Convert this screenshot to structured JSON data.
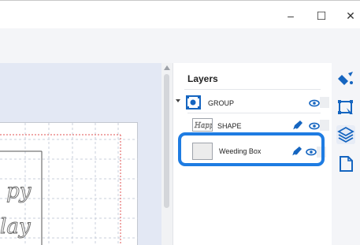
{
  "window": {
    "minimize_glyph": "–",
    "maximize_glyph": "☐",
    "close_glyph": "✕"
  },
  "layers_panel": {
    "title": "Layers",
    "layers": [
      {
        "label": "GROUP",
        "icon": "group-icon",
        "expanded": true,
        "visible": true
      },
      {
        "label": "SHAPE",
        "icon": "shape-thumbnail",
        "visible": true,
        "has_edit_pen": true
      },
      {
        "label": "Weeding Box",
        "icon": "weeding-box-thumbnail",
        "visible": true,
        "has_edit_pen": true,
        "highlighted": true
      }
    ]
  },
  "colors": {
    "accent": "#1e7ce2",
    "icon_blue": "#1565c0",
    "canvas_bg": "#e3e8f4",
    "cut_line_red": "#e05050"
  },
  "right_rail": {
    "tools": [
      "paint-bucket-icon",
      "select-region-icon",
      "layers-icon",
      "page-icon"
    ],
    "active_tool": "layers-icon"
  }
}
